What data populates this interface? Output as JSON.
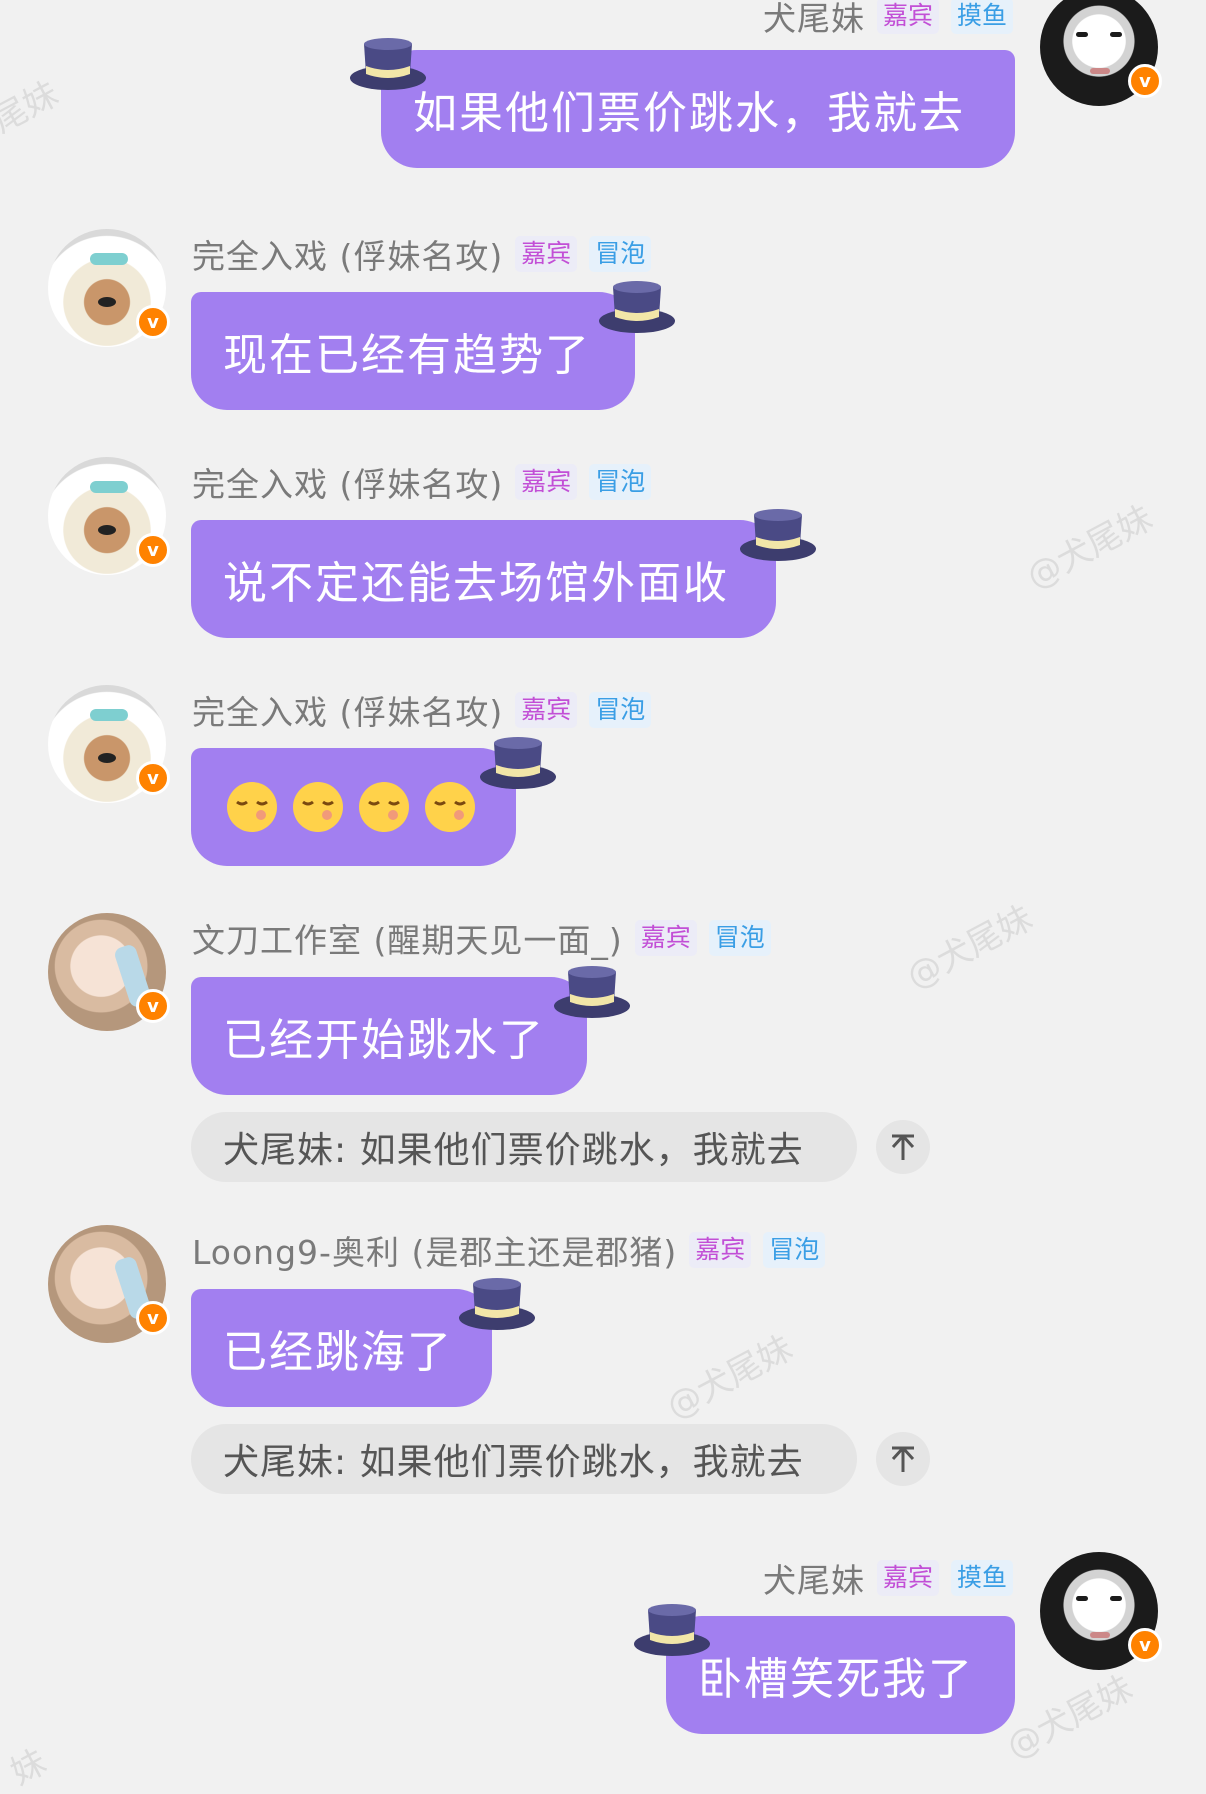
{
  "watermarks": [
    "尾妹",
    "@犬尾妹",
    "@犬尾妹",
    "@犬尾妹",
    "@犬尾妹",
    "妹"
  ],
  "tags": {
    "guest": "嘉宾",
    "bubble_tag": "冒泡",
    "fish": "摸鱼"
  },
  "badge": "v",
  "messages": [
    {
      "user": "犬尾妹",
      "text": "如果他们票价跳水，我就去"
    },
    {
      "user": "完全入戏 (俘妹名攻)",
      "text": "现在已经有趋势了"
    },
    {
      "user": "完全入戏 (俘妹名攻)",
      "text": "说不定还能去场馆外面收"
    },
    {
      "user": "完全入戏 (俘妹名攻)",
      "text": ""
    },
    {
      "user": "文刀工作室 (醒期天见一面_)",
      "text": "已经开始跳水了",
      "quote": "犬尾妹: 如果他们票价跳水，我就去"
    },
    {
      "user": "Loong9-奥利 (是郡主还是郡猪)",
      "text": "已经跳海了",
      "quote": "犬尾妹: 如果他们票价跳水，我就去"
    },
    {
      "user": "犬尾妹",
      "text": "卧槽笑死我了"
    }
  ]
}
